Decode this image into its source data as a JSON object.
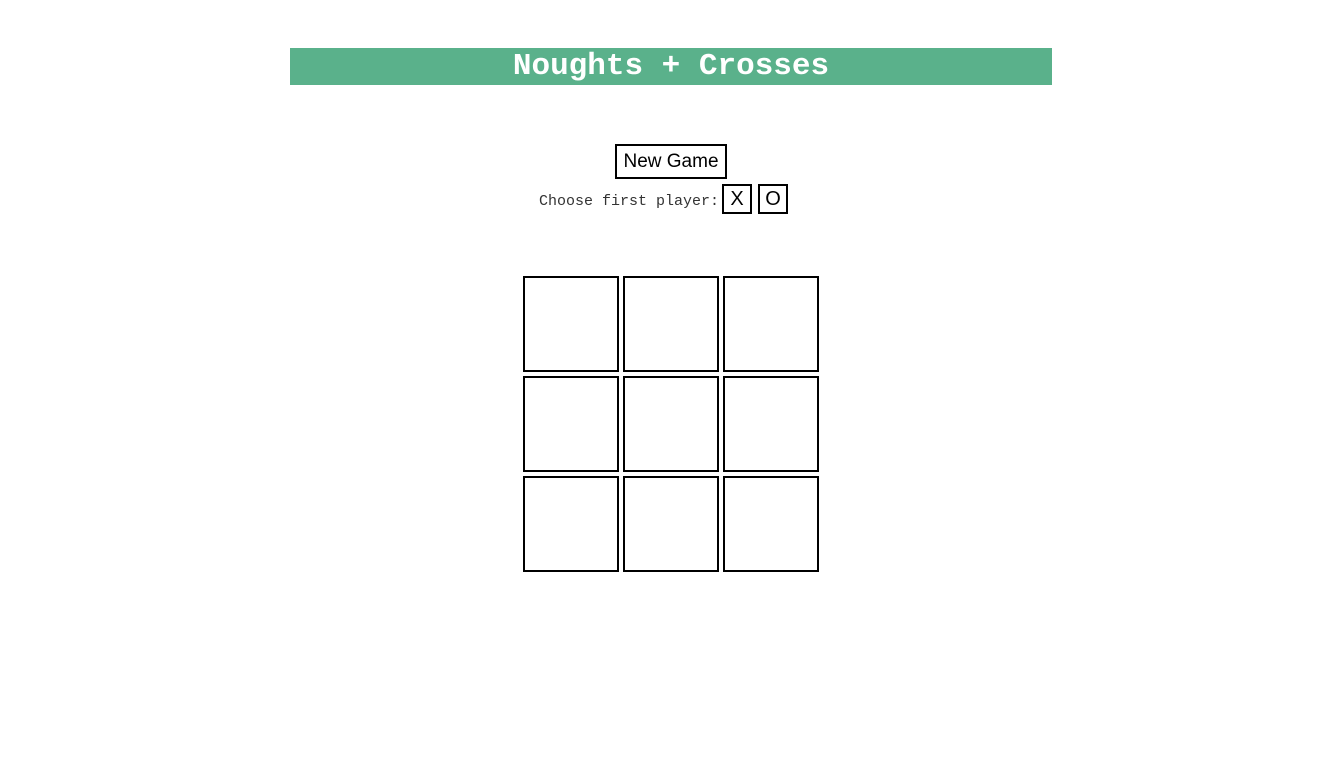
{
  "header": {
    "title": "Noughts + Crosses"
  },
  "controls": {
    "new_game_label": "New Game",
    "first_player_label": "Choose first player:",
    "player_x_label": "X",
    "player_o_label": "O"
  },
  "board": {
    "cells": [
      "",
      "",
      "",
      "",
      "",
      "",
      "",
      "",
      ""
    ]
  },
  "colors": {
    "header_bg": "#5ab18b",
    "header_text": "#ffffff",
    "border": "#000000"
  }
}
